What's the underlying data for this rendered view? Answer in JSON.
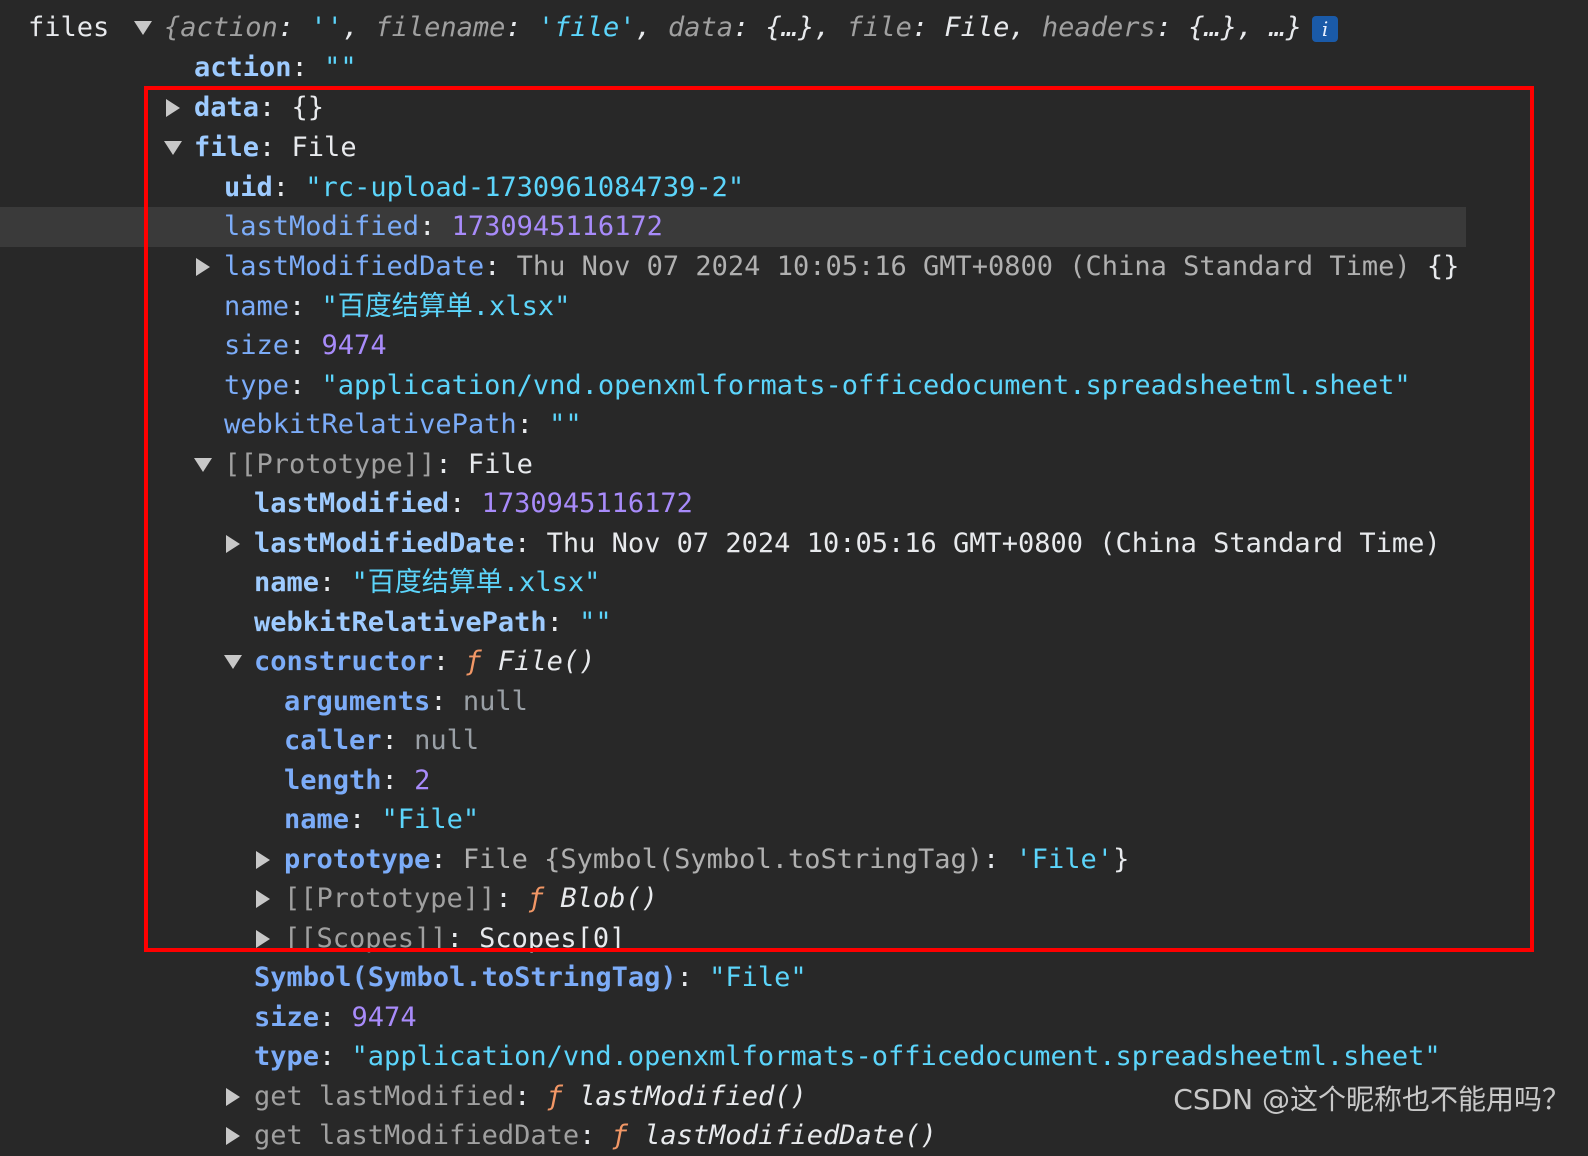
{
  "header": {
    "label": "files",
    "preview_open": "{",
    "preview_k1": "action",
    "preview_colon": ": ",
    "preview_v1": "''",
    "preview_sep": ", ",
    "preview_k2": "filename",
    "preview_v2": "'file'",
    "preview_k3": "data",
    "preview_v3": "{…}",
    "preview_k4": "file",
    "preview_v4": "File",
    "preview_k5": "headers",
    "preview_v5": "{…}",
    "preview_tail": ", …}",
    "info": "i"
  },
  "action": {
    "key": "action",
    "value": "\"\""
  },
  "data": {
    "key": "data",
    "value": "{}"
  },
  "file": {
    "key": "file",
    "value": "File",
    "uid": {
      "key": "uid",
      "value": "\"rc-upload-1730961084739-2\""
    },
    "lastModified": {
      "key": "lastModified",
      "value": "1730945116172"
    },
    "lastModifiedDate": {
      "key": "lastModifiedDate",
      "value": "Thu Nov 07 2024 10:05:16 GMT+0800 (China Standard Time)",
      "suffix": "{}"
    },
    "name": {
      "key": "name",
      "value": "\"百度结算单.xlsx\""
    },
    "size": {
      "key": "size",
      "value": "9474"
    },
    "type": {
      "key": "type",
      "value": "\"application/vnd.openxmlformats-officedocument.spreadsheetml.sheet\""
    },
    "webkitRelativePath": {
      "key": "webkitRelativePath",
      "value": "\"\""
    },
    "proto": {
      "key": "[[Prototype]]",
      "value": "File",
      "lastModified": {
        "key": "lastModified",
        "value": "1730945116172"
      },
      "lastModifiedDate": {
        "key": "lastModifiedDate",
        "value": "Thu Nov 07 2024 10:05:16 GMT+0800 (China Standard Time)"
      },
      "name": {
        "key": "name",
        "value": "\"百度结算单.xlsx\""
      },
      "webkitRelativePath": {
        "key": "webkitRelativePath",
        "value": "\"\""
      },
      "constructor": {
        "key": "constructor",
        "f": "ƒ",
        "value": "File()",
        "arguments": {
          "key": "arguments",
          "value": "null"
        },
        "caller": {
          "key": "caller",
          "value": "null"
        },
        "length": {
          "key": "length",
          "value": "2"
        },
        "name": {
          "key": "name",
          "value": "\"File\""
        },
        "prototype": {
          "key": "prototype",
          "value_a": "File {",
          "value_b": "Symbol(Symbol.toStringTag)",
          "value_c": ": ",
          "value_d": "'File'",
          "value_e": "}"
        },
        "proto": {
          "key": "[[Prototype]]",
          "f": "ƒ",
          "value": "Blob()"
        },
        "scopes": {
          "key": "[[Scopes]]",
          "value": "Scopes[0]"
        }
      },
      "toStringTag": {
        "key": "Symbol(Symbol.toStringTag)",
        "value": "\"File\""
      },
      "size": {
        "key": "size",
        "value": "9474"
      },
      "type": {
        "key": "type",
        "value": "\"application/vnd.openxmlformats-officedocument.spreadsheetml.sheet\""
      },
      "getLastModified": {
        "key": "get lastModified",
        "f": "ƒ",
        "value": "lastModified()"
      },
      "getLastModifiedDate": {
        "key": "get lastModifiedDate",
        "f": "ƒ",
        "value": "lastModifiedDate()"
      }
    }
  },
  "watermark": "CSDN @这个昵称也不能用吗？",
  "colors": {
    "background": "#282828",
    "key": "#9ecbff",
    "string": "#5cd5fb",
    "number": "#a88bfa",
    "function": "#f29766",
    "highlight": "#ff0000"
  },
  "icons": {
    "expanded": "triangle-down-icon",
    "collapsed": "triangle-right-icon",
    "info": "info-icon"
  }
}
